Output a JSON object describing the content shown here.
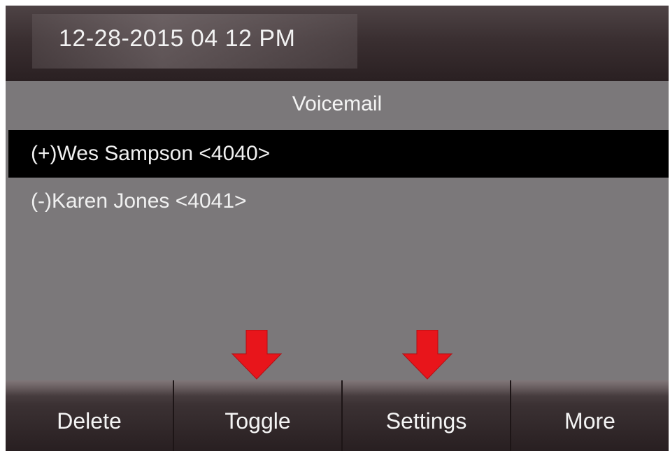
{
  "status_bar": {
    "datetime": "12-28-2015 04 12 PM"
  },
  "screen": {
    "title": "Voicemail"
  },
  "voicemail_list": {
    "items": [
      {
        "label": "(+)Wes Sampson <4040>",
        "selected": true
      },
      {
        "label": "(-)Karen Jones <4041>",
        "selected": false
      }
    ]
  },
  "softkeys": [
    {
      "label": "Delete"
    },
    {
      "label": "Toggle"
    },
    {
      "label": "Settings"
    },
    {
      "label": "More"
    }
  ],
  "annotations": {
    "arrow_color": "#e8151b",
    "arrow_icon": "down-arrow-icon",
    "highlighted_softkeys": [
      "Toggle",
      "Settings"
    ]
  },
  "colors": {
    "screen_background": "#7b787a",
    "selected_row": "#000000",
    "bar_dark": "#2a2022"
  }
}
